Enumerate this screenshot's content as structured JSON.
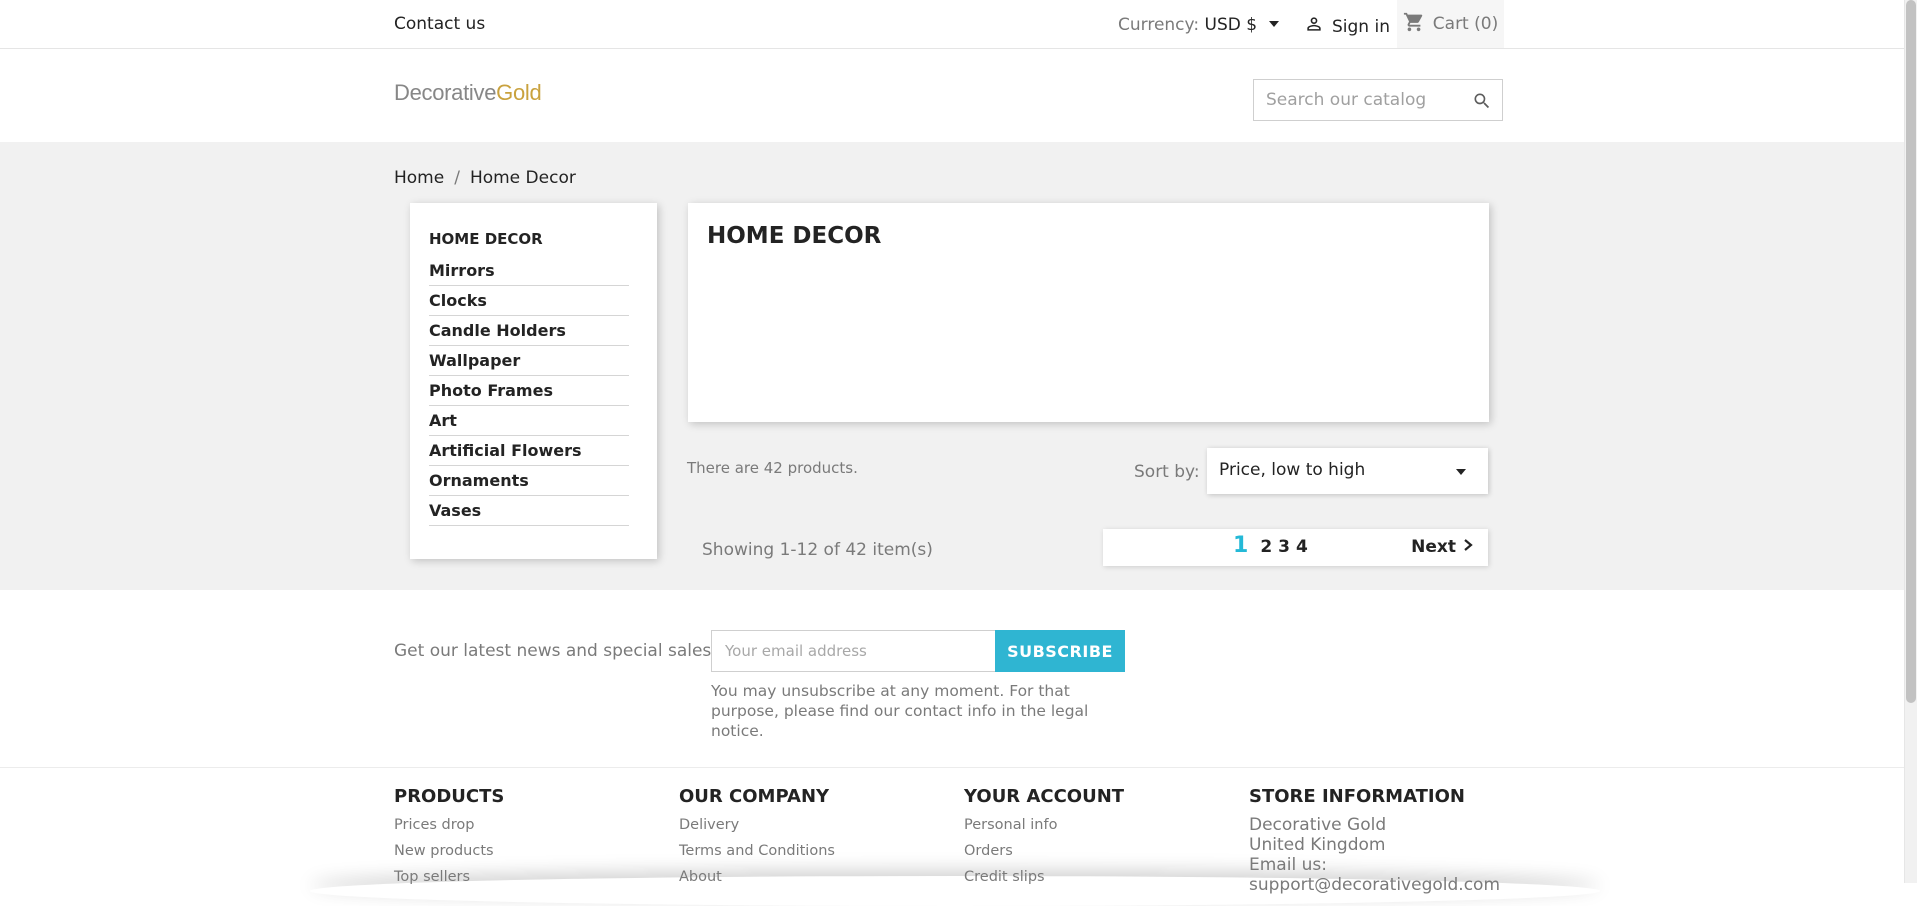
{
  "topnav": {
    "contact": "Contact us",
    "currency_label": "Currency:",
    "currency_value": "USD $",
    "signin": "Sign in",
    "cart": "Cart (0)"
  },
  "header": {
    "logo_part1": "Decorative",
    "logo_part2": "Gold",
    "search_placeholder": "Search our catalog"
  },
  "breadcrumb": {
    "home": "Home",
    "separator": "/",
    "current": "Home Decor"
  },
  "sidebar": {
    "heading": "Home Decor",
    "items": [
      "Mirrors",
      "Clocks",
      "Candle Holders",
      "Wallpaper",
      "Photo Frames",
      "Art",
      "Artificial Flowers",
      "Ornaments",
      "Vases"
    ]
  },
  "category": {
    "title": "Home Decor"
  },
  "listing": {
    "count_text": "There are 42 products.",
    "sort_label": "Sort by:",
    "sort_value": "Price, low to high",
    "showing": "Showing 1-12 of 42 item(s)",
    "pages": [
      "1",
      "2",
      "3",
      "4"
    ],
    "current_page": "1",
    "next": "Next"
  },
  "newsletter": {
    "label": "Get our latest news and special sales",
    "placeholder": "Your email address",
    "button": "Subscribe",
    "note": "You may unsubscribe at any moment. For that purpose, please find our contact info in the legal notice."
  },
  "footer": {
    "products": {
      "title": "Products",
      "links": [
        "Prices drop",
        "New products",
        "Top sellers"
      ]
    },
    "company": {
      "title": "Our company",
      "links": [
        "Delivery",
        "Terms and Conditions",
        "About"
      ]
    },
    "account": {
      "title": "Your account",
      "links": [
        "Personal info",
        "Orders",
        "Credit slips"
      ]
    },
    "store": {
      "title": "Store information",
      "lines": [
        "Decorative Gold",
        "United Kingdom",
        "Email us:",
        "support@decorativegold.com"
      ]
    }
  },
  "colors": {
    "accent": "#2fb5d2",
    "current_page": "#24b9d7",
    "logo_gold": "#c9a23e",
    "logo_grey": "#878787",
    "wrapper_bg": "#f1f1f1"
  }
}
